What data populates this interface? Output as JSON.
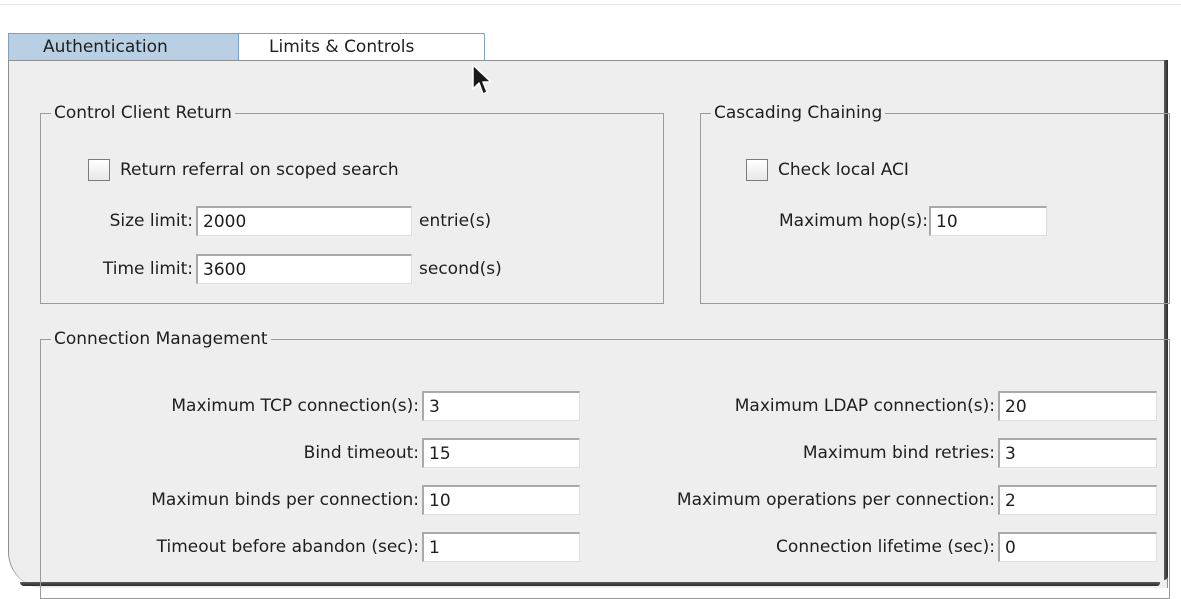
{
  "tabs": {
    "authentication": "Authentication",
    "limits_controls": "Limits & Controls"
  },
  "control_client_return": {
    "title": "Control Client Return",
    "return_referral_label": "Return referral on scoped search",
    "return_referral_checked": false,
    "size_limit_label": "Size limit:",
    "size_limit_value": "2000",
    "size_limit_unit": "entrie(s)",
    "time_limit_label": "Time limit:",
    "time_limit_value": "3600",
    "time_limit_unit": "second(s)"
  },
  "cascading_chaining": {
    "title": "Cascading Chaining",
    "check_local_aci_label": "Check local ACI",
    "check_local_aci_checked": false,
    "max_hops_label": "Maximum hop(s):",
    "max_hops_value": "10"
  },
  "connection_management": {
    "title": "Connection Management",
    "max_tcp_label": "Maximum TCP connection(s):",
    "max_tcp_value": "3",
    "bind_timeout_label": "Bind timeout:",
    "bind_timeout_value": "15",
    "max_binds_label": "Maximun binds per connection:",
    "max_binds_value": "10",
    "timeout_abandon_label": "Timeout before abandon (sec):",
    "timeout_abandon_value": "1",
    "max_ldap_label": "Maximum LDAP connection(s):",
    "max_ldap_value": "20",
    "max_bind_retries_label": "Maximum bind retries:",
    "max_bind_retries_value": "3",
    "max_ops_label": "Maximum operations per connection:",
    "max_ops_value": "2",
    "conn_lifetime_label": "Connection lifetime (sec):",
    "conn_lifetime_value": "0"
  },
  "icons": {
    "cursor": "mouse-pointer-icon"
  },
  "colors": {
    "panel_bg": "#eeeeee",
    "tab_selected_bg": "#b9cfe3",
    "tab_border": "#7fa0bf"
  }
}
